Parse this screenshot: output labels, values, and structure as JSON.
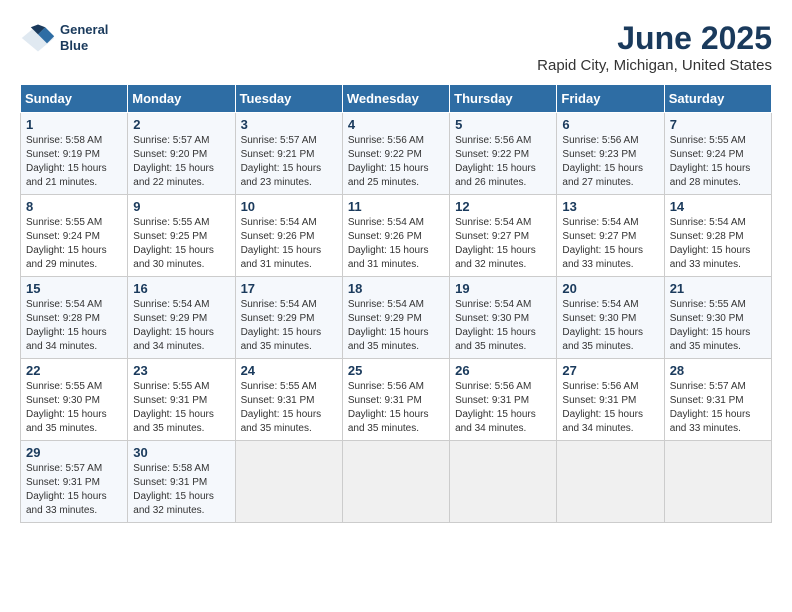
{
  "header": {
    "logo_line1": "General",
    "logo_line2": "Blue",
    "title": "June 2025",
    "subtitle": "Rapid City, Michigan, United States"
  },
  "calendar": {
    "days_of_week": [
      "Sunday",
      "Monday",
      "Tuesday",
      "Wednesday",
      "Thursday",
      "Friday",
      "Saturday"
    ],
    "weeks": [
      [
        {
          "day": "",
          "empty": true
        },
        {
          "day": "",
          "empty": true
        },
        {
          "day": "",
          "empty": true
        },
        {
          "day": "",
          "empty": true
        },
        {
          "day": "",
          "empty": true
        },
        {
          "day": "",
          "empty": true
        },
        {
          "day": "",
          "empty": true
        }
      ],
      [
        {
          "day": "1",
          "sunrise": "5:58 AM",
          "sunset": "9:19 PM",
          "daylight": "15 hours and 21 minutes."
        },
        {
          "day": "2",
          "sunrise": "5:57 AM",
          "sunset": "9:20 PM",
          "daylight": "15 hours and 22 minutes."
        },
        {
          "day": "3",
          "sunrise": "5:57 AM",
          "sunset": "9:21 PM",
          "daylight": "15 hours and 23 minutes."
        },
        {
          "day": "4",
          "sunrise": "5:56 AM",
          "sunset": "9:22 PM",
          "daylight": "15 hours and 25 minutes."
        },
        {
          "day": "5",
          "sunrise": "5:56 AM",
          "sunset": "9:22 PM",
          "daylight": "15 hours and 26 minutes."
        },
        {
          "day": "6",
          "sunrise": "5:56 AM",
          "sunset": "9:23 PM",
          "daylight": "15 hours and 27 minutes."
        },
        {
          "day": "7",
          "sunrise": "5:55 AM",
          "sunset": "9:24 PM",
          "daylight": "15 hours and 28 minutes."
        }
      ],
      [
        {
          "day": "8",
          "sunrise": "5:55 AM",
          "sunset": "9:24 PM",
          "daylight": "15 hours and 29 minutes."
        },
        {
          "day": "9",
          "sunrise": "5:55 AM",
          "sunset": "9:25 PM",
          "daylight": "15 hours and 30 minutes."
        },
        {
          "day": "10",
          "sunrise": "5:54 AM",
          "sunset": "9:26 PM",
          "daylight": "15 hours and 31 minutes."
        },
        {
          "day": "11",
          "sunrise": "5:54 AM",
          "sunset": "9:26 PM",
          "daylight": "15 hours and 31 minutes."
        },
        {
          "day": "12",
          "sunrise": "5:54 AM",
          "sunset": "9:27 PM",
          "daylight": "15 hours and 32 minutes."
        },
        {
          "day": "13",
          "sunrise": "5:54 AM",
          "sunset": "9:27 PM",
          "daylight": "15 hours and 33 minutes."
        },
        {
          "day": "14",
          "sunrise": "5:54 AM",
          "sunset": "9:28 PM",
          "daylight": "15 hours and 33 minutes."
        }
      ],
      [
        {
          "day": "15",
          "sunrise": "5:54 AM",
          "sunset": "9:28 PM",
          "daylight": "15 hours and 34 minutes."
        },
        {
          "day": "16",
          "sunrise": "5:54 AM",
          "sunset": "9:29 PM",
          "daylight": "15 hours and 34 minutes."
        },
        {
          "day": "17",
          "sunrise": "5:54 AM",
          "sunset": "9:29 PM",
          "daylight": "15 hours and 35 minutes."
        },
        {
          "day": "18",
          "sunrise": "5:54 AM",
          "sunset": "9:29 PM",
          "daylight": "15 hours and 35 minutes."
        },
        {
          "day": "19",
          "sunrise": "5:54 AM",
          "sunset": "9:30 PM",
          "daylight": "15 hours and 35 minutes."
        },
        {
          "day": "20",
          "sunrise": "5:54 AM",
          "sunset": "9:30 PM",
          "daylight": "15 hours and 35 minutes."
        },
        {
          "day": "21",
          "sunrise": "5:55 AM",
          "sunset": "9:30 PM",
          "daylight": "15 hours and 35 minutes."
        }
      ],
      [
        {
          "day": "22",
          "sunrise": "5:55 AM",
          "sunset": "9:30 PM",
          "daylight": "15 hours and 35 minutes."
        },
        {
          "day": "23",
          "sunrise": "5:55 AM",
          "sunset": "9:31 PM",
          "daylight": "15 hours and 35 minutes."
        },
        {
          "day": "24",
          "sunrise": "5:55 AM",
          "sunset": "9:31 PM",
          "daylight": "15 hours and 35 minutes."
        },
        {
          "day": "25",
          "sunrise": "5:56 AM",
          "sunset": "9:31 PM",
          "daylight": "15 hours and 35 minutes."
        },
        {
          "day": "26",
          "sunrise": "5:56 AM",
          "sunset": "9:31 PM",
          "daylight": "15 hours and 34 minutes."
        },
        {
          "day": "27",
          "sunrise": "5:56 AM",
          "sunset": "9:31 PM",
          "daylight": "15 hours and 34 minutes."
        },
        {
          "day": "28",
          "sunrise": "5:57 AM",
          "sunset": "9:31 PM",
          "daylight": "15 hours and 33 minutes."
        }
      ],
      [
        {
          "day": "29",
          "sunrise": "5:57 AM",
          "sunset": "9:31 PM",
          "daylight": "15 hours and 33 minutes."
        },
        {
          "day": "30",
          "sunrise": "5:58 AM",
          "sunset": "9:31 PM",
          "daylight": "15 hours and 32 minutes."
        },
        {
          "day": "",
          "empty": true
        },
        {
          "day": "",
          "empty": true
        },
        {
          "day": "",
          "empty": true
        },
        {
          "day": "",
          "empty": true
        },
        {
          "day": "",
          "empty": true
        }
      ]
    ]
  }
}
